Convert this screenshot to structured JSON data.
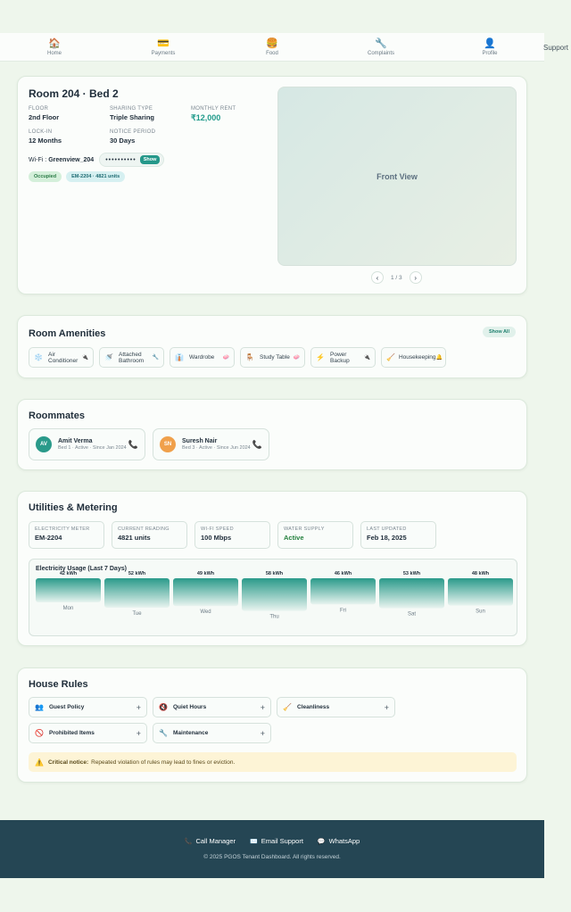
{
  "nav": {
    "items": [
      {
        "icon": "🏠",
        "label": "Home"
      },
      {
        "icon": "💳",
        "label": "Payments"
      },
      {
        "icon": "🍔",
        "label": "Food"
      },
      {
        "icon": "🔧",
        "label": "Complaints"
      },
      {
        "icon": "👤",
        "label": "Profile"
      }
    ],
    "support": "Support"
  },
  "room": {
    "title": "Room 204 · Bed 2",
    "floor_label": "FLOOR",
    "floor": "2nd Floor",
    "sharing_label": "SHARING TYPE",
    "sharing": "Triple Sharing",
    "rent_label": "MONTHLY RENT",
    "rent": "₹12,000",
    "lockin_label": "LOCK-IN",
    "lockin": "12 Months",
    "notice_label": "NOTICE PERIOD",
    "notice": "30 Days",
    "wifi_label": "Wi-Fi :",
    "wifi_name": "Greenview_204",
    "wifi_password": "••••••••••",
    "wifi_show": "Show",
    "status": "Occupied",
    "meter_badge": "EM-2204 · 4821 units",
    "photo_label": "Front View",
    "gallery_count": "1 / 3"
  },
  "amenities": {
    "title": "Room Amenities",
    "show_all": "Show All",
    "items": [
      {
        "icon": "❄️",
        "label": "Air Conditioner",
        "tag": "🔌"
      },
      {
        "icon": "🚿",
        "label": "Attached Bathroom",
        "tag": "🔧"
      },
      {
        "icon": "👔",
        "label": "Wardrobe",
        "tag": "🧼"
      },
      {
        "icon": "🪑",
        "label": "Study Table",
        "tag": "🧼"
      },
      {
        "icon": "⚡",
        "label": "Power Backup",
        "tag": "🔌"
      },
      {
        "icon": "🧹",
        "label": "Housekeeping",
        "tag": "🔔"
      }
    ]
  },
  "roommates": {
    "title": "Roommates",
    "items": [
      {
        "initials": "AV",
        "name": "Amit Verma",
        "meta": "Bed 1 · Active · Since Jan 2024",
        "color": "#2a9a8a"
      },
      {
        "initials": "SN",
        "name": "Suresh Nair",
        "meta": "Bed 3 · Active · Since Jun 2024",
        "color": "#f0a04b"
      }
    ]
  },
  "utilities": {
    "title": "Utilities & Metering",
    "meters": [
      {
        "label": "ELECTRICITY METER",
        "value": "EM-2204"
      },
      {
        "label": "CURRENT READING",
        "value": "4821 units"
      },
      {
        "label": "WI-FI SPEED",
        "value": "100 Mbps"
      },
      {
        "label": "WATER SUPPLY",
        "value": "Active"
      },
      {
        "label": "LAST UPDATED",
        "value": "Feb 18, 2025"
      }
    ],
    "chart_title": "Electricity Usage (Last 7 Days)"
  },
  "chart_data": {
    "type": "bar",
    "title": "Electricity Usage (Last 7 Days)",
    "categories": [
      "Mon",
      "Tue",
      "Wed",
      "Thu",
      "Fri",
      "Sat",
      "Sun"
    ],
    "values": [
      42,
      52,
      49,
      58,
      46,
      53,
      48
    ],
    "value_labels": [
      "42 kWh",
      "52 kWh",
      "49 kWh",
      "58 kWh",
      "46 kWh",
      "53 kWh",
      "48 kWh"
    ],
    "unit": "kWh",
    "bar_color": "#2a9a8a"
  },
  "rules": {
    "title": "House Rules",
    "items": [
      {
        "icon": "👥",
        "label": "Guest Policy"
      },
      {
        "icon": "🔇",
        "label": "Quiet Hours"
      },
      {
        "icon": "🧹",
        "label": "Cleanliness"
      },
      {
        "icon": "🚫",
        "label": "Prohibited Items"
      },
      {
        "icon": "🔧",
        "label": "Maintenance"
      }
    ],
    "notice_strong": "Critical notice:",
    "notice_text": "Repeated violation of rules may lead to fines or eviction."
  },
  "footer": {
    "links": [
      {
        "icon": "📞",
        "label": "Call Manager"
      },
      {
        "icon": "✉️",
        "label": "Email Support"
      },
      {
        "icon": "💬",
        "label": "WhatsApp"
      }
    ],
    "copyright": "© 2025 PGOS Tenant Dashboard. All rights reserved."
  }
}
